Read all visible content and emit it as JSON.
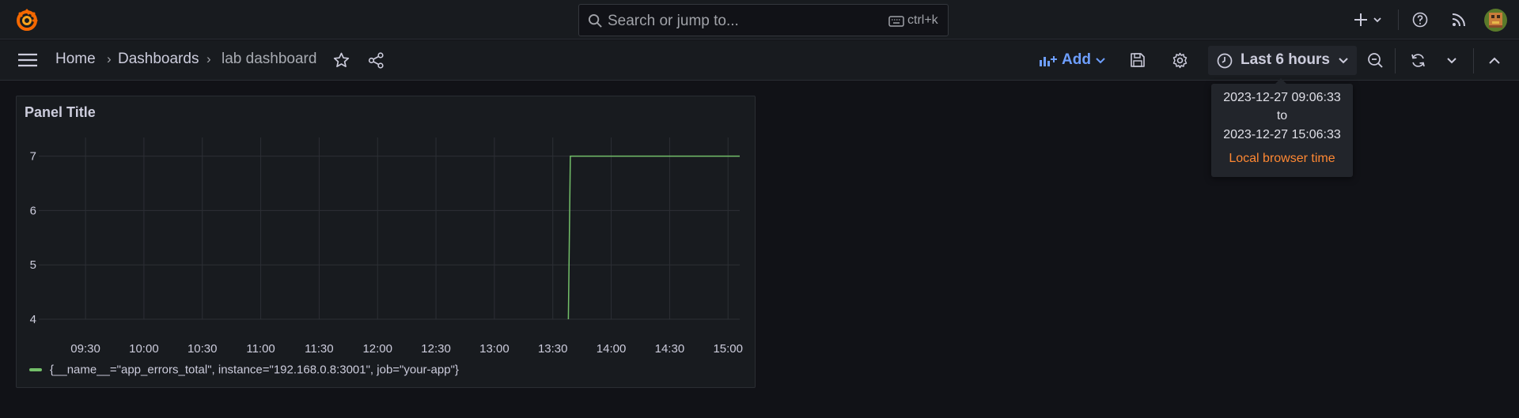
{
  "topbar": {
    "search_placeholder": "Search or jump to...",
    "search_shortcut": "ctrl+k"
  },
  "breadcrumb": {
    "home": "Home",
    "dashboards": "Dashboards",
    "current": "lab dashboard",
    "separator": "›"
  },
  "toolbar": {
    "add_label": "Add",
    "time_range_label": "Last 6 hours"
  },
  "time_tooltip": {
    "from": "2023-12-27 09:06:33",
    "to_word": "to",
    "to": "2023-12-27 15:06:33",
    "timezone": "Local browser time"
  },
  "panel": {
    "title": "Panel Title",
    "legend": "{__name__=\"app_errors_total\", instance=\"192.168.0.8:3001\", job=\"your-app\"}"
  },
  "colors": {
    "background": "#111217",
    "panel": "#181b1f",
    "series": "#73bf69",
    "accent_blue": "#6e9fff",
    "accent_orange": "#ff8833"
  },
  "chart_data": {
    "type": "line",
    "title": "Panel Title",
    "xlabel": "",
    "ylabel": "",
    "x_ticks": [
      "09:30",
      "10:00",
      "10:30",
      "11:00",
      "11:30",
      "12:00",
      "12:30",
      "13:00",
      "13:30",
      "14:00",
      "14:30",
      "15:00"
    ],
    "y_ticks": [
      4,
      5,
      6,
      7
    ],
    "xlim": [
      "09:06",
      "15:06"
    ],
    "ylim": [
      4,
      7.3
    ],
    "grid": true,
    "legend_position": "bottom-left",
    "series": [
      {
        "name": "{__name__=\"app_errors_total\", instance=\"192.168.0.8:3001\", job=\"your-app\"}",
        "color": "#73bf69",
        "points": [
          [
            "13:38",
            4
          ],
          [
            "13:39",
            7
          ],
          [
            "15:06",
            7
          ]
        ]
      }
    ]
  }
}
